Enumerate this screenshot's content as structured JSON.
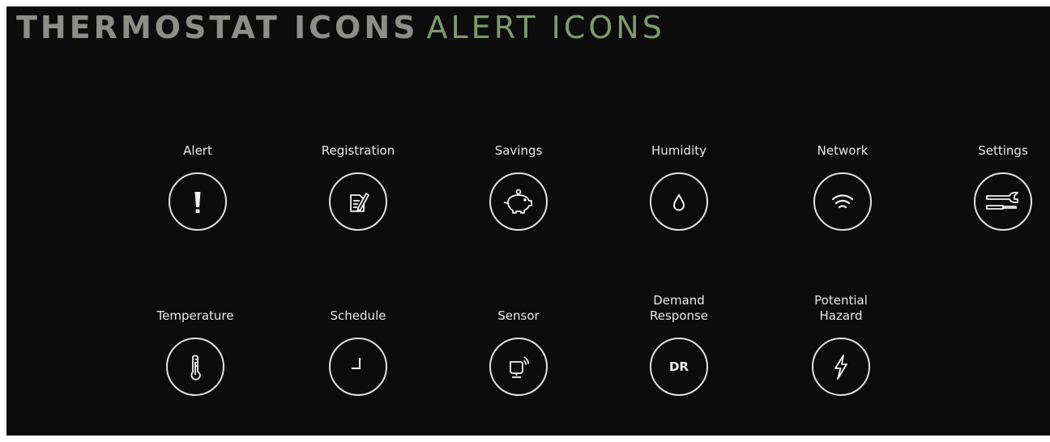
{
  "heading": {
    "part1": "THERMOSTAT ICONS",
    "part2": "ALERT ICONS"
  },
  "colors": {
    "background": "#0c0c0c",
    "heading_gray": "#8e8e89",
    "heading_green": "#7f9a6e",
    "icon_stroke": "#e2e2e2"
  },
  "icons": [
    {
      "label": "Alert",
      "icon": "exclamation-icon"
    },
    {
      "label": "Registration",
      "icon": "document-pen-icon"
    },
    {
      "label": "Savings",
      "icon": "piggy-bank-icon"
    },
    {
      "label": "Humidity",
      "icon": "water-drop-icon"
    },
    {
      "label": "Network",
      "icon": "wifi-icon"
    },
    {
      "label": "Settings",
      "icon": "wrench-screwdriver-icon"
    },
    {
      "label": "Temperature",
      "icon": "thermometer-icon"
    },
    {
      "label": "Schedule",
      "icon": "clock-hands-icon"
    },
    {
      "label": "Sensor",
      "icon": "sensor-icon"
    },
    {
      "label_line1": "Demand",
      "label_line2": "Response",
      "icon": "dr-icon",
      "icon_text": "DR"
    },
    {
      "label_line1": "Potential",
      "label_line2": "Hazard",
      "icon": "lightning-bolt-icon"
    }
  ]
}
